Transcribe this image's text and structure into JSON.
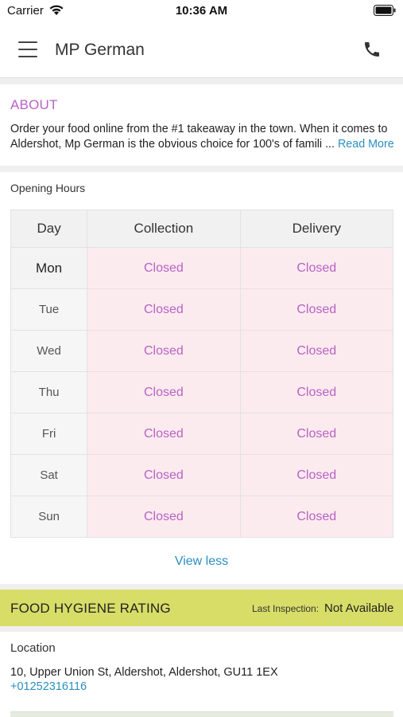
{
  "status_bar": {
    "carrier": "Carrier",
    "time": "10:36 AM"
  },
  "nav": {
    "title": "MP German",
    "menu_icon": "hamburger-menu-icon",
    "phone_icon": "phone-icon"
  },
  "about": {
    "heading": "ABOUT",
    "line1": "Order your food online from the #1 takeaway in the town. When it comes to",
    "line2": "Aldershot, Mp German is the obvious choice for 100's of famili ...",
    "read_more": "Read More"
  },
  "opening_hours": {
    "label": "Opening Hours",
    "headers": {
      "day": "Day",
      "collection": "Collection",
      "delivery": "Delivery"
    },
    "rows": [
      {
        "day": "Mon",
        "collection": "Closed",
        "delivery": "Closed"
      },
      {
        "day": "Tue",
        "collection": "Closed",
        "delivery": "Closed"
      },
      {
        "day": "Wed",
        "collection": "Closed",
        "delivery": "Closed"
      },
      {
        "day": "Thu",
        "collection": "Closed",
        "delivery": "Closed"
      },
      {
        "day": "Fri",
        "collection": "Closed",
        "delivery": "Closed"
      },
      {
        "day": "Sat",
        "collection": "Closed",
        "delivery": "Closed"
      },
      {
        "day": "Sun",
        "collection": "Closed",
        "delivery": "Closed"
      }
    ],
    "toggle": "View less"
  },
  "hygiene": {
    "title": "FOOD HYGIENE RATING",
    "last_inspection_label": "Last Inspection:",
    "last_inspection_value": "Not Available"
  },
  "location": {
    "title": "Location",
    "address": "10, Upper Union St, Aldershot, Aldershot, GU11 1EX",
    "phone": "+01252316116"
  },
  "colors": {
    "accent": "#b862c6",
    "link": "#2a8fbf",
    "hygiene_bg": "#d8dd68",
    "closed_bg": "#fcebee"
  }
}
